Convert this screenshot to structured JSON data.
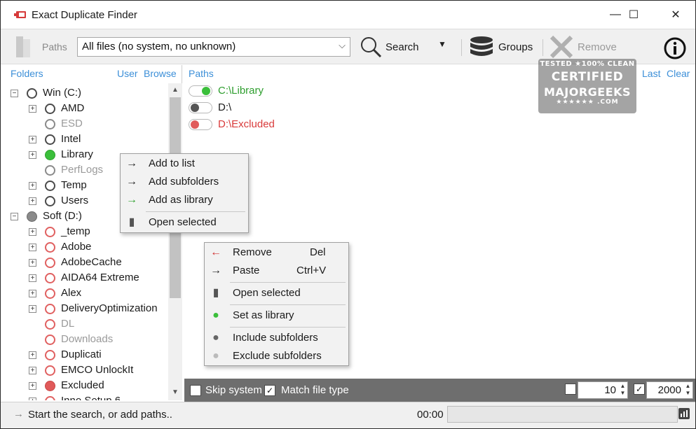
{
  "window": {
    "title": "Exact Duplicate Finder",
    "minimize_glyph": "—",
    "maximize_glyph": "☐",
    "close_glyph": "✕"
  },
  "toolbar": {
    "paths_label": "Paths",
    "filter_value": "All files (no system, no unknown)",
    "search_label": "Search",
    "groups_label": "Groups",
    "remove_label": "Remove"
  },
  "watermark": {
    "line1": "TESTED ★100% CLEAN",
    "line2": "CERTIFIED",
    "line3": "MAJORGEEKS",
    "line4": "★★★★★★ .COM"
  },
  "folders": {
    "header": "Folders",
    "user_link": "User",
    "browse_link": "Browse",
    "tree": [
      {
        "label": "Win (C:)",
        "level": 0,
        "expander": "⊟",
        "marker": "empty",
        "label_style": "normal"
      },
      {
        "label": "AMD",
        "level": 1,
        "expander": "+",
        "marker": "empty",
        "label_style": "normal"
      },
      {
        "label": "ESD",
        "level": 1,
        "expander": "",
        "marker": "empty-grey",
        "label_style": "grey"
      },
      {
        "label": "Intel",
        "level": 1,
        "expander": "+",
        "marker": "empty",
        "label_style": "normal"
      },
      {
        "label": "Library",
        "level": 1,
        "expander": "+",
        "marker": "green",
        "label_style": "normal"
      },
      {
        "label": "PerfLogs",
        "level": 1,
        "expander": "",
        "marker": "empty-grey",
        "label_style": "grey"
      },
      {
        "label": "Temp",
        "level": 1,
        "expander": "+",
        "marker": "empty",
        "label_style": "normal"
      },
      {
        "label": "Users",
        "level": 1,
        "expander": "+",
        "marker": "empty",
        "label_style": "normal"
      },
      {
        "label": "Soft (D:)",
        "level": 0,
        "expander": "⊟",
        "marker": "grey",
        "label_style": "normal"
      },
      {
        "label": "_temp",
        "level": 1,
        "expander": "+",
        "marker": "red-ring",
        "label_style": "normal"
      },
      {
        "label": "Adobe",
        "level": 1,
        "expander": "+",
        "marker": "red-ring",
        "label_style": "normal"
      },
      {
        "label": "AdobeCache",
        "level": 1,
        "expander": "+",
        "marker": "red-ring",
        "label_style": "normal"
      },
      {
        "label": "AIDA64 Extreme",
        "level": 1,
        "expander": "+",
        "marker": "red-ring",
        "label_style": "normal"
      },
      {
        "label": "Alex",
        "level": 1,
        "expander": "+",
        "marker": "red-ring",
        "label_style": "normal"
      },
      {
        "label": "DeliveryOptimization",
        "level": 1,
        "expander": "+",
        "marker": "red-ring",
        "label_style": "normal"
      },
      {
        "label": "DL",
        "level": 1,
        "expander": "",
        "marker": "red-ring",
        "label_style": "grey"
      },
      {
        "label": "Downloads",
        "level": 1,
        "expander": "",
        "marker": "red-ring",
        "label_style": "grey"
      },
      {
        "label": "Duplicati",
        "level": 1,
        "expander": "+",
        "marker": "red-ring",
        "label_style": "normal"
      },
      {
        "label": "EMCO UnlockIt",
        "level": 1,
        "expander": "+",
        "marker": "red-ring",
        "label_style": "normal"
      },
      {
        "label": "Excluded",
        "level": 1,
        "expander": "+",
        "marker": "red",
        "label_style": "normal"
      },
      {
        "label": "Inno Setup 6",
        "level": 1,
        "expander": "+",
        "marker": "red-ring",
        "label_style": "normal"
      }
    ]
  },
  "paths_pane": {
    "header": "Paths",
    "last_link": "Last",
    "clear_link": "Clear",
    "items": [
      {
        "path": "C:\\Library",
        "state": "library",
        "color": "#2e9e2e"
      },
      {
        "path": "D:\\",
        "state": "included",
        "color": "#1a1a1a"
      },
      {
        "path": "D:\\Excluded",
        "state": "excluded",
        "color": "#d93a3a"
      }
    ]
  },
  "folder_context_menu": {
    "items": [
      {
        "label": "Add to list",
        "icon": "arrow-right-icon",
        "glyph": "→",
        "color": "#222222"
      },
      {
        "label": "Add subfolders",
        "icon": "arrow-right-icon",
        "glyph": "→",
        "color": "#222222"
      },
      {
        "label": "Add as library",
        "icon": "green-arrow-right-icon",
        "glyph": "→",
        "color": "#2ea02e"
      },
      {
        "label": "Open selected",
        "icon": "folder-open-icon",
        "glyph": "▮",
        "color": "#555555"
      }
    ]
  },
  "path_context_menu": {
    "items": [
      {
        "label": "Remove",
        "shortcut": "Del",
        "icon": "red-arrow-left-icon",
        "glyph": "←",
        "color": "#d03030"
      },
      {
        "label": "Paste",
        "shortcut": "Ctrl+V",
        "icon": "arrow-right-icon",
        "glyph": "→",
        "color": "#222222"
      },
      {
        "label": "Open selected",
        "shortcut": "",
        "icon": "folder-open-icon",
        "glyph": "▮",
        "color": "#555555"
      },
      {
        "label": "Set as library",
        "shortcut": "",
        "icon": "green-circle-icon",
        "glyph": "●",
        "color": "#3bbf3b"
      },
      {
        "label": "Include subfolders",
        "shortcut": "",
        "icon": "dark-circle-icon",
        "glyph": "●",
        "color": "#666666"
      },
      {
        "label": "Exclude subfolders",
        "shortcut": "",
        "icon": "light-circle-icon",
        "glyph": "●",
        "color": "#bbbbbb"
      }
    ]
  },
  "options": {
    "skip_system_label": "Skip system",
    "skip_system_checked": false,
    "match_file_type_label": "Match file type",
    "match_file_type_checked": true,
    "min_enabled": false,
    "min_value": "10",
    "max_enabled": true,
    "max_value": "2000",
    "check_glyph": "✓"
  },
  "status": {
    "message": "Start the search, or add paths..",
    "time": "00:00",
    "progress": 0
  },
  "colors": {
    "link": "#3c8fd8",
    "library_green": "#3bbf3b",
    "excluded_red": "#e05a5a"
  }
}
